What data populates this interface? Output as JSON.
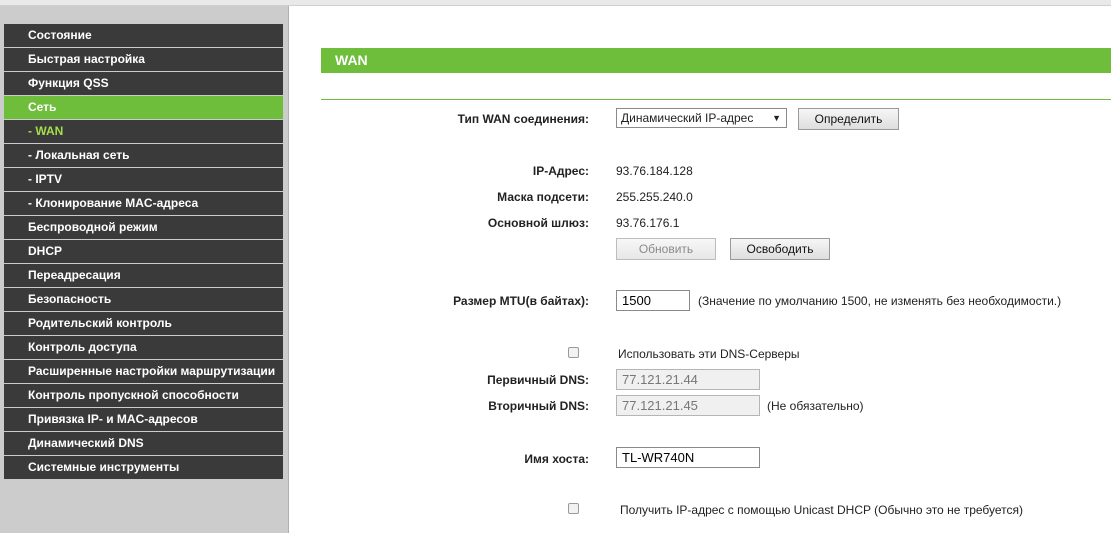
{
  "sidebar": {
    "items": [
      {
        "label": "Состояние"
      },
      {
        "label": "Быстрая настройка"
      },
      {
        "label": "Функция QSS"
      },
      {
        "label": "Сеть"
      },
      {
        "label": "- WAN"
      },
      {
        "label": "- Локальная сеть"
      },
      {
        "label": "- IPTV"
      },
      {
        "label": "- Клонирование MAC-адреса"
      },
      {
        "label": "Беспроводной режим"
      },
      {
        "label": "DHCP"
      },
      {
        "label": "Переадресация"
      },
      {
        "label": "Безопасность"
      },
      {
        "label": "Родительский контроль"
      },
      {
        "label": "Контроль доступа"
      },
      {
        "label": "Расширенные настройки маршрутизации"
      },
      {
        "label": "Контроль пропускной способности"
      },
      {
        "label": "Привязка IP- и MAC-адресов"
      },
      {
        "label": "Динамический DNS"
      },
      {
        "label": "Системные инструменты"
      }
    ]
  },
  "page": {
    "title": "WAN"
  },
  "form": {
    "wan_type_label": "Тип WAN соединения:",
    "wan_type_value": "Динамический IP-адрес",
    "detect_button": "Определить",
    "ip_label": "IP-Адрес:",
    "ip_value": "93.76.184.128",
    "mask_label": "Маска подсети:",
    "mask_value": "255.255.240.0",
    "gateway_label": "Основной шлюз:",
    "gateway_value": "93.76.176.1",
    "renew_button": "Обновить",
    "release_button": "Освободить",
    "mtu_label": "Размер MTU(в байтах):",
    "mtu_value": "1500",
    "mtu_note": "(Значение по умолчанию 1500, не изменять без необходимости.)",
    "use_dns_label": "Использовать эти DNS-Серверы",
    "primary_dns_label": "Первичный DNS:",
    "primary_dns_value": "77.121.21.44",
    "secondary_dns_label": "Вторичный DNS:",
    "secondary_dns_value": "77.121.21.45",
    "secondary_dns_note": "(Не обязательно)",
    "hostname_label": "Имя хоста:",
    "hostname_value": "TL-WR740N",
    "unicast_label": "Получить IP-адрес с помощью Unicast DHCP (Обычно это не требуется)"
  },
  "colors": {
    "accent": "#6ebd3b",
    "menu_bg": "#3a3a3a",
    "sidebar_bg": "#cccccc"
  }
}
